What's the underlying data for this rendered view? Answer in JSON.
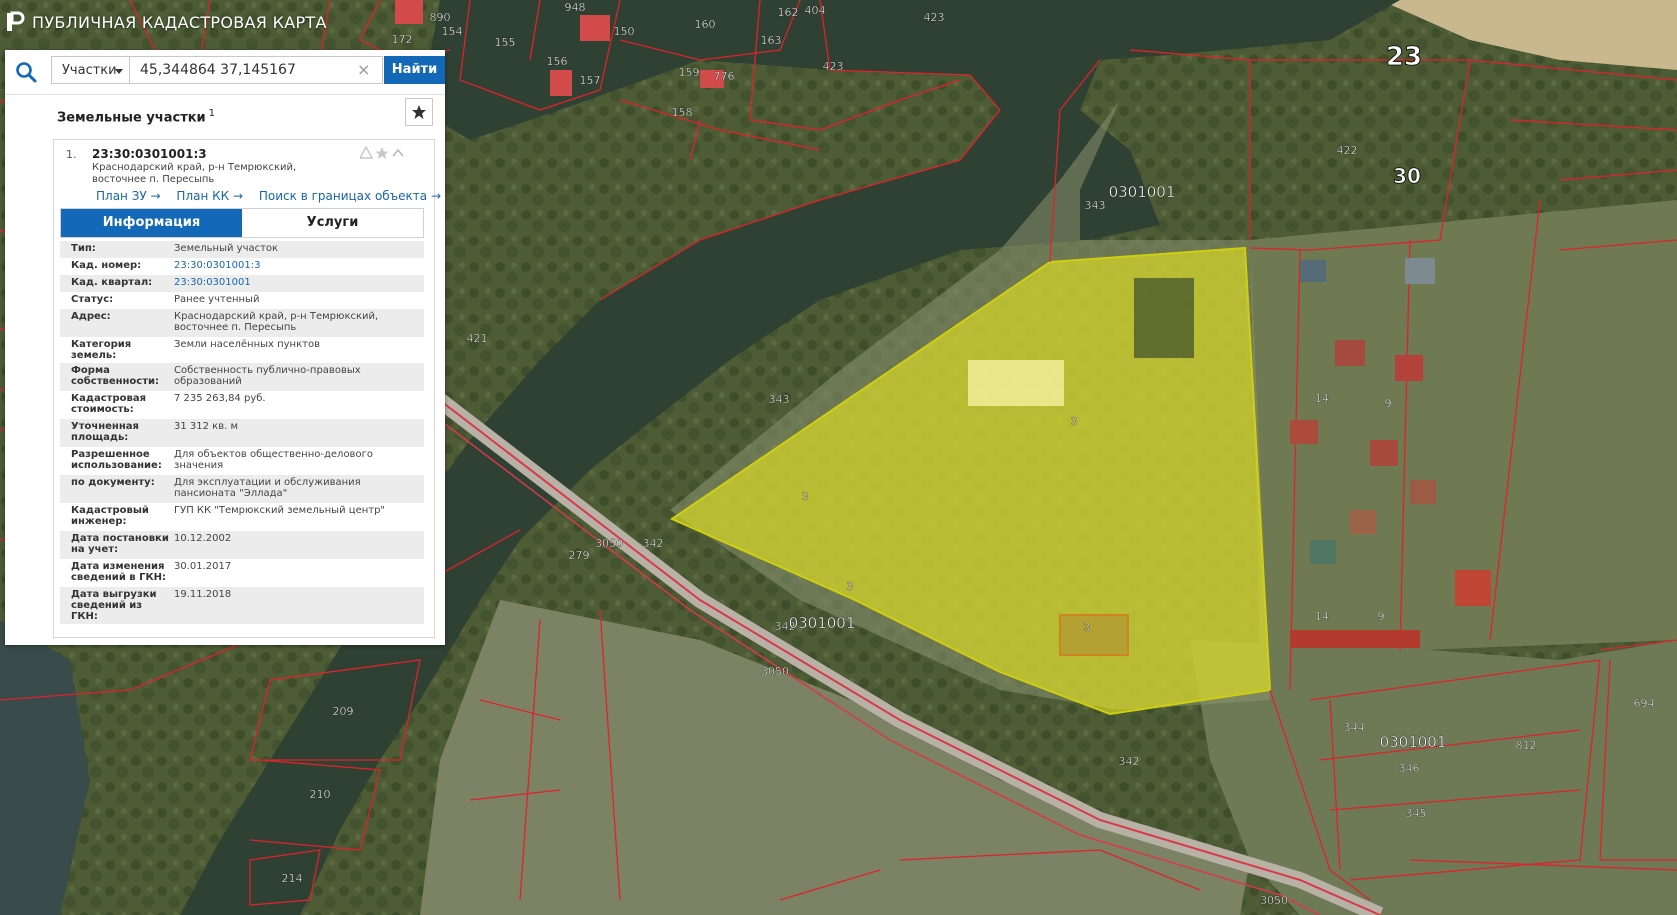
{
  "app": {
    "title": "ПУБЛИЧНАЯ КАДАСТРОВАЯ КАРТА"
  },
  "search": {
    "type_label": "Участки",
    "query": "45,344864 37,145167",
    "find_label": "Найти",
    "clear_glyph": "×"
  },
  "results": {
    "title": "Земельные участки",
    "count": "1"
  },
  "item": {
    "index": "1.",
    "cad_number": "23:30:0301001:3",
    "address": "Краснодарский край, р-н Темрюкский, восточнее п. Пересыпь",
    "links": [
      "План ЗУ →",
      "План КК →",
      "Поиск в границах объекта →"
    ]
  },
  "tabs": [
    "Информация",
    "Услуги"
  ],
  "info": [
    {
      "label": "Тип:",
      "value": "Земельный участок"
    },
    {
      "label": "Кад. номер:",
      "value": "23:30:0301001:3",
      "link": true
    },
    {
      "label": "Кад. квартал:",
      "value": "23:30:0301001",
      "link": true
    },
    {
      "label": "Статус:",
      "value": "Ранее учтенный"
    },
    {
      "label": "Адрес:",
      "value": "Краснодарский край, р-н Темрюкский, восточнее п. Пересыпь"
    },
    {
      "label": "Категория земель:",
      "value": "Земли населённых пунктов"
    },
    {
      "label": "Форма собственности:",
      "value": "Собственность публично-правовых образований"
    },
    {
      "label": "Кадастровая стоимость:",
      "value": "7 235 263,84 руб."
    },
    {
      "label": "Уточненная площадь:",
      "value": "31 312 кв. м"
    },
    {
      "label": "Разрешенное использование:",
      "value": "Для объектов общественно-делового значения"
    },
    {
      "label": "по документу:",
      "value": "Для эксплуатации и обслуживания пансионата \"Эллада\""
    },
    {
      "label": "Кадастровый инженер:",
      "value": "ГУП КК \"Темрюкский земельный центр\""
    },
    {
      "label": "Дата постановки на учет:",
      "value": "10.12.2002"
    },
    {
      "label": "Дата изменения сведений в ГКН:",
      "value": "30.01.2017"
    },
    {
      "label": "Дата выгрузки сведений из ГКН:",
      "value": "19.11.2018"
    }
  ],
  "map": {
    "district_labels": [
      "23",
      "30"
    ],
    "quarter_labels": [
      "0301001",
      "0301001",
      "0301001"
    ],
    "parcel_labels": [
      "890",
      "154",
      "172",
      "155",
      "156",
      "157",
      "948",
      "150",
      "160",
      "162",
      "404",
      "423",
      "163",
      "159",
      "776",
      "158",
      "423",
      "343",
      "422",
      "421",
      "343",
      "3",
      "3",
      "3",
      "3",
      "3",
      "14",
      "9",
      "14",
      "9",
      "279",
      "3050",
      "342",
      "342",
      "3050",
      "342",
      "344",
      "346",
      "345",
      "812",
      "694",
      "209",
      "210",
      "214",
      "3050",
      "3"
    ],
    "colors": {
      "parcel_border": "#e0222b",
      "selected_fill": "#e6e61f",
      "accent": "#1468b8"
    }
  }
}
